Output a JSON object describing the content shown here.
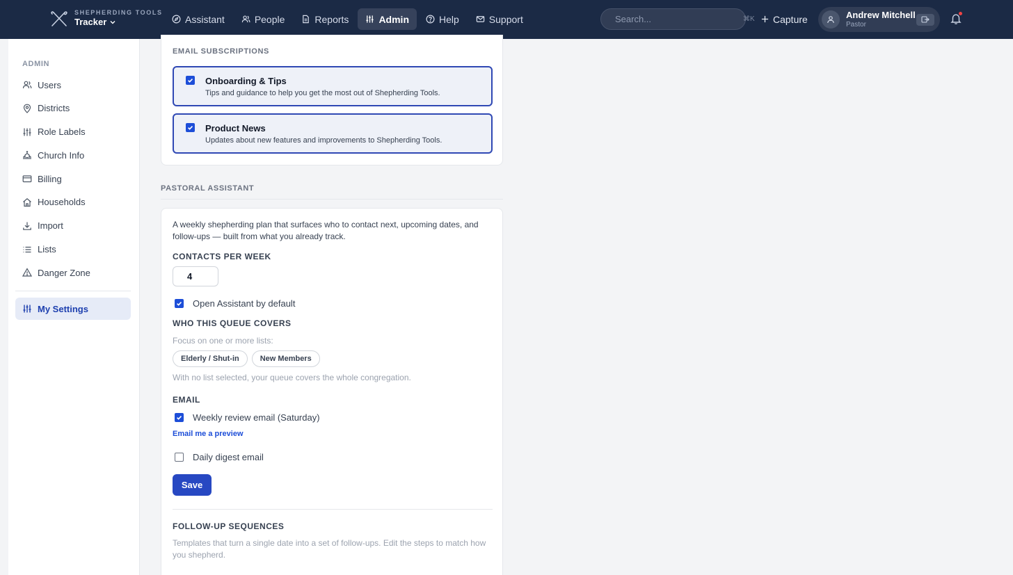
{
  "brand": {
    "small": "SHEPHERDING TOOLS",
    "name": "Tracker"
  },
  "nav": [
    {
      "label": "Assistant",
      "icon": "compass-icon"
    },
    {
      "label": "People",
      "icon": "users-icon"
    },
    {
      "label": "Reports",
      "icon": "file-icon"
    },
    {
      "label": "Admin",
      "icon": "sliders-icon",
      "active": true
    },
    {
      "label": "Help",
      "icon": "help-circle-icon"
    },
    {
      "label": "Support",
      "icon": "mail-icon"
    }
  ],
  "search": {
    "placeholder": "Search...",
    "shortcut": "⌘K"
  },
  "capture_label": "Capture",
  "user": {
    "name": "Andrew Mitchell",
    "role": "Pastor"
  },
  "sidebar": {
    "heading": "ADMIN",
    "items": [
      {
        "label": "Users",
        "icon": "users-icon"
      },
      {
        "label": "Districts",
        "icon": "map-pin-icon"
      },
      {
        "label": "Role Labels",
        "icon": "sliders-icon"
      },
      {
        "label": "Church Info",
        "icon": "church-icon"
      },
      {
        "label": "Billing",
        "icon": "credit-card-icon"
      },
      {
        "label": "Households",
        "icon": "home-icon"
      },
      {
        "label": "Import",
        "icon": "download-icon"
      },
      {
        "label": "Lists",
        "icon": "list-icon"
      },
      {
        "label": "Danger Zone",
        "icon": "warning-icon"
      }
    ],
    "active": {
      "label": "My Settings",
      "icon": "sliders-icon"
    }
  },
  "email_subscriptions": {
    "heading": "EMAIL SUBSCRIPTIONS",
    "items": [
      {
        "title": "Onboarding & Tips",
        "desc": "Tips and guidance to help you get the most out of Shepherding Tools.",
        "checked": true
      },
      {
        "title": "Product News",
        "desc": "Updates about new features and improvements to Shepherding Tools.",
        "checked": true
      }
    ]
  },
  "pastoral_assistant": {
    "heading": "PASTORAL ASSISTANT",
    "intro": "A weekly shepherding plan that surfaces who to contact next, upcoming dates, and follow-ups — built from what you already track.",
    "contacts_label": "CONTACTS PER WEEK",
    "contacts_value": "4",
    "open_default_label": "Open Assistant by default",
    "open_default_checked": true,
    "queue_label": "WHO THIS QUEUE COVERS",
    "queue_hint": "Focus on one or more lists:",
    "lists": [
      "Elderly / Shut-in",
      "New Members"
    ],
    "queue_note": "With no list selected, your queue covers the whole congregation.",
    "email_label": "EMAIL",
    "weekly_label": "Weekly review email (Saturday)",
    "weekly_checked": true,
    "preview_link": "Email me a preview",
    "daily_label": "Daily digest email",
    "daily_checked": false,
    "save_label": "Save",
    "followup_label": "FOLLOW-UP SEQUENCES",
    "followup_desc": "Templates that turn a single date into a set of follow-ups. Edit the steps to match how you shepherd."
  }
}
